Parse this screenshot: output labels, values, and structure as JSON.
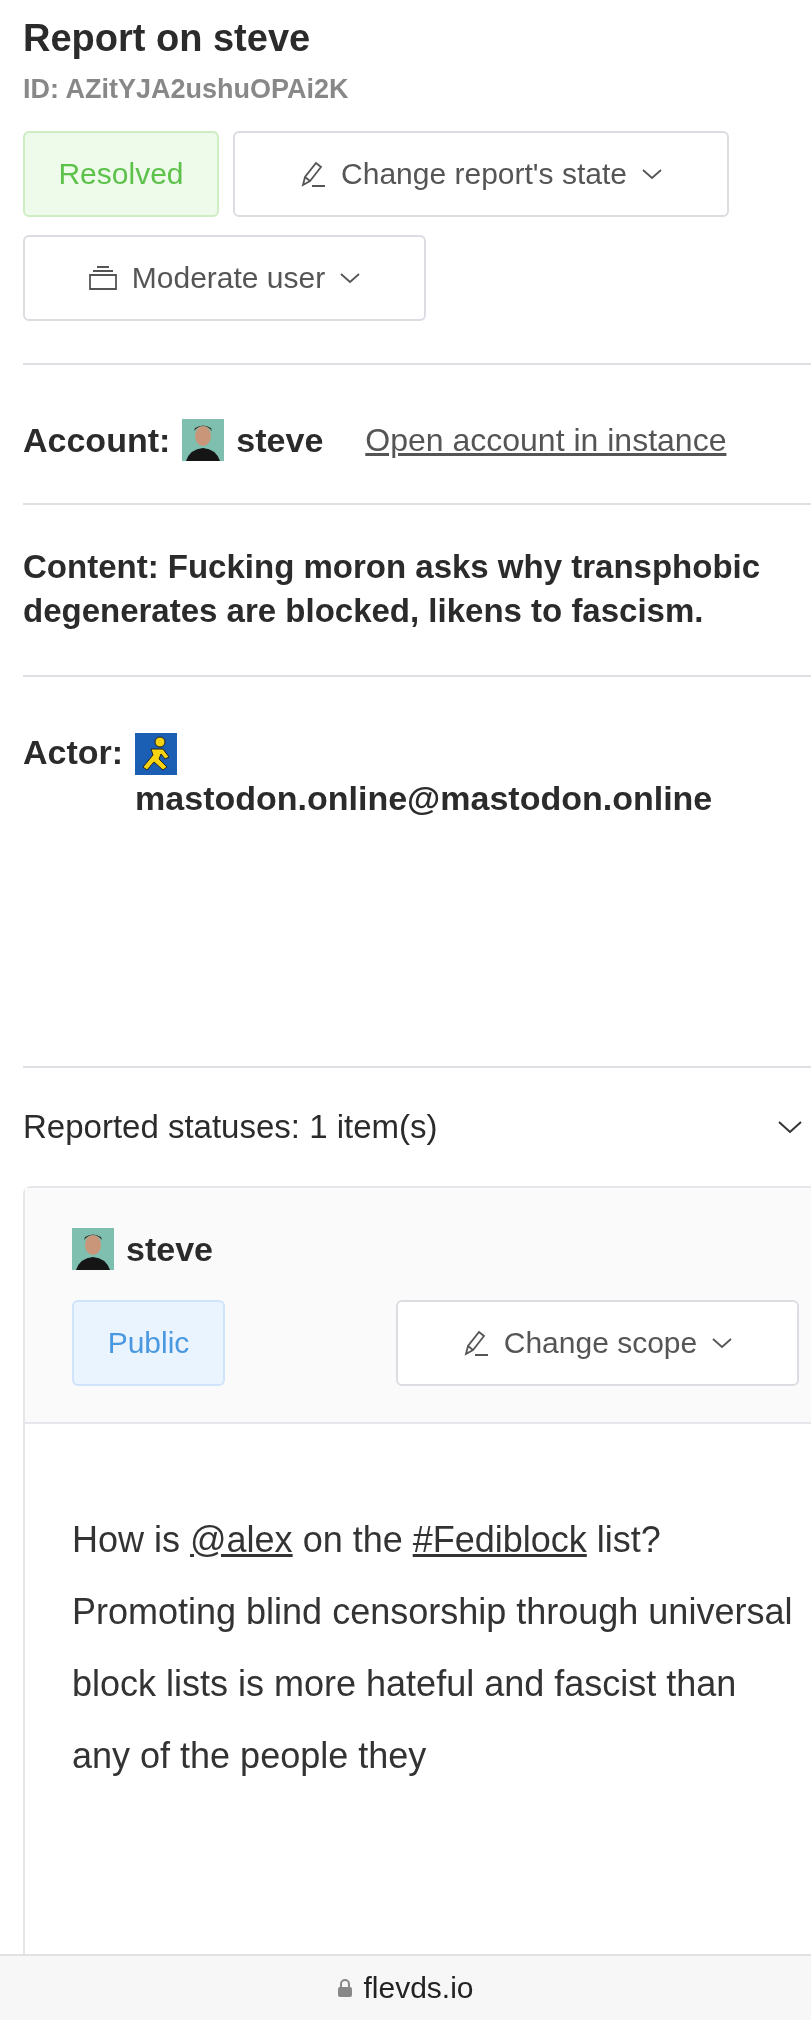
{
  "title": "Report on steve",
  "report_id": "ID: AZitYJA2ushuOPAi2K",
  "state_badge": {
    "label": "Resolved",
    "kind": "resolved"
  },
  "state_button": "Change report's state",
  "moderate_button": "Moderate user",
  "account": {
    "label": "Account:",
    "name": "steve",
    "link": "Open account in instance"
  },
  "content": "Content: Fucking moron asks why transphobic degenerates are blocked, likens to fascism.",
  "actor": {
    "label": "Actor:",
    "name": "mastodon.online@mastodon.online"
  },
  "reported_statuses": {
    "title": "Reported statuses: 1 item(s)",
    "expanded": true,
    "statuses": [
      {
        "author": "steve",
        "visibility": {
          "label": "Public",
          "kind": "public"
        },
        "scope_button": "Change scope",
        "text": [
          {
            "kind": "text",
            "text": "How is "
          },
          {
            "kind": "mention",
            "text": "@alex"
          },
          {
            "kind": "text",
            "text": " on the "
          },
          {
            "kind": "hashtag",
            "text": "#Fediblock"
          },
          {
            "kind": "text",
            "text": " list? Promoting blind censorship through universal block lists is more hateful and fascist than any of the people they"
          }
        ]
      }
    ]
  },
  "browser_bar": {
    "domain": "flevds.io"
  }
}
